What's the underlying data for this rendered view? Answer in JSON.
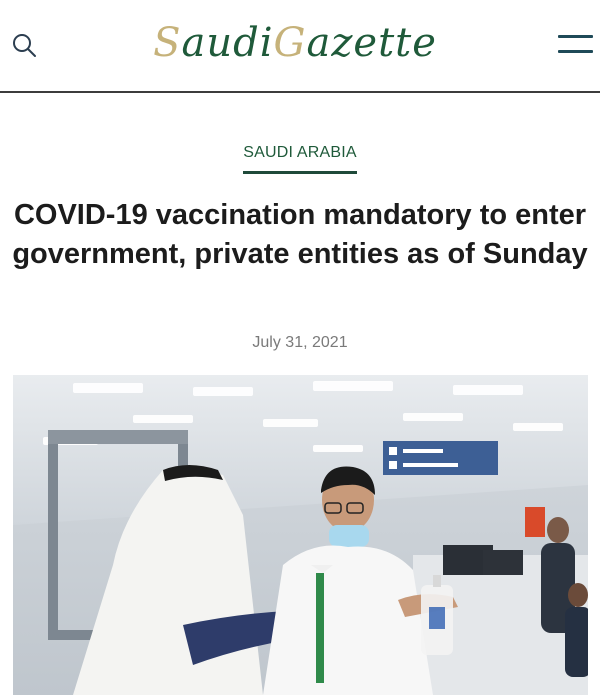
{
  "header": {
    "logo_main": "Saudi Gazette",
    "logo_part1": "S",
    "logo_part2": "audi ",
    "logo_part3": "G",
    "logo_part4": "azette",
    "brand_green": "#1f5a3a",
    "brand_gold": "#c6b27a",
    "search_icon": "search-icon",
    "menu_icon": "hamburger-menu-icon"
  },
  "article": {
    "category": "SAUDI ARABIA",
    "headline": "COVID-19 vaccination mandatory to enter government, private entities as of Sunday",
    "date": "July 31, 2021",
    "photo": "photo of a man in traditional dress receiving hand sanitizer from a masked staff member at a checkpoint"
  }
}
